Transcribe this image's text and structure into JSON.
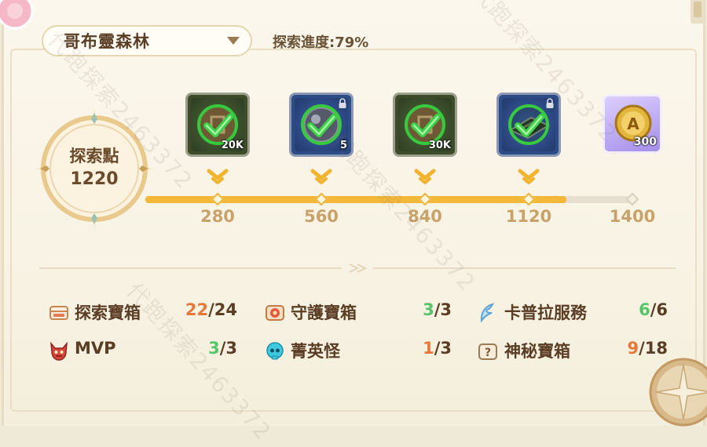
{
  "header": {
    "map_name": "哥布靈森林",
    "progress_text": "探索進度:79%"
  },
  "points": {
    "title": "探索點",
    "value": "1220",
    "current": 1220,
    "max": 1400
  },
  "milestones": [
    {
      "label": "280",
      "value": 280,
      "reward_count": "20K",
      "claimed": true,
      "style": "brown",
      "locked": false,
      "icon": "zeny-coin-icon"
    },
    {
      "label": "560",
      "value": 560,
      "reward_count": "5",
      "claimed": true,
      "style": "blue",
      "locked": true,
      "icon": "crystal-orb-icon"
    },
    {
      "label": "840",
      "value": 840,
      "reward_count": "30K",
      "claimed": true,
      "style": "brown",
      "locked": false,
      "icon": "zeny-coin-icon"
    },
    {
      "label": "1120",
      "value": 1120,
      "reward_count": "",
      "claimed": true,
      "style": "blue",
      "locked": true,
      "icon": "material-bundle-icon"
    },
    {
      "label": "1400",
      "value": 1400,
      "reward_count": "300",
      "claimed": false,
      "style": "purple",
      "locked": false,
      "icon": "gold-coin-a-icon"
    }
  ],
  "stats": [
    {
      "label": "探索寶箱",
      "current": "22",
      "total": "/24",
      "icon": "treasure-chest-icon",
      "color": "#e8783a"
    },
    {
      "label": "守護寶箱",
      "current": "3",
      "total": "/3",
      "icon": "guardian-chest-icon",
      "color": "#55c56a"
    },
    {
      "label": "卡普拉服務",
      "current": "6",
      "total": "/6",
      "icon": "kafra-wing-icon",
      "color": "#55c56a"
    },
    {
      "label": "MVP",
      "current": "3",
      "total": "/3",
      "icon": "demon-head-icon",
      "color": "#55c56a"
    },
    {
      "label": "菁英怪",
      "current": "1",
      "total": "/3",
      "icon": "skull-icon",
      "color": "#e8783a"
    },
    {
      "label": "神秘寶箱",
      "current": "9",
      "total": "/18",
      "icon": "mystery-box-icon",
      "color": "#e8783a"
    }
  ],
  "colors": {
    "track_fill": "#f3b83a",
    "check_green": "#37c93e",
    "text_brown": "#5a3d24",
    "milestone_label": "#c9a26a"
  }
}
